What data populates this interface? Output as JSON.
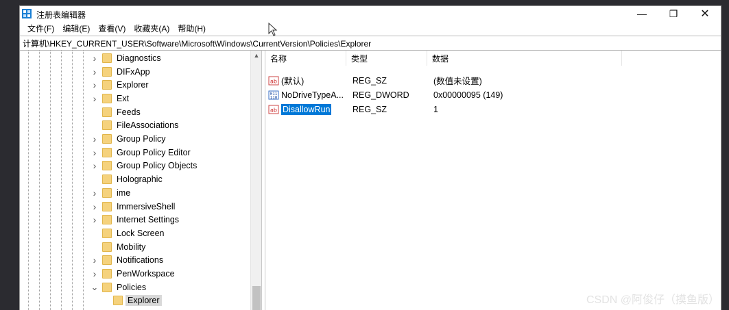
{
  "window": {
    "title": "注册表编辑器",
    "controls": {
      "minimize": "—",
      "maximize": "❐",
      "close": "✕"
    }
  },
  "menu": [
    "文件(F)",
    "编辑(E)",
    "查看(V)",
    "收藏夹(A)",
    "帮助(H)"
  ],
  "address": "计算机\\HKEY_CURRENT_USER\\Software\\Microsoft\\Windows\\CurrentVersion\\Policies\\Explorer",
  "tree": {
    "items": [
      {
        "label": "Diagnostics",
        "expandable": true
      },
      {
        "label": "DIFxApp",
        "expandable": true
      },
      {
        "label": "Explorer",
        "expandable": true
      },
      {
        "label": "Ext",
        "expandable": true
      },
      {
        "label": "Feeds",
        "expandable": false
      },
      {
        "label": "FileAssociations",
        "expandable": false
      },
      {
        "label": "Group Policy",
        "expandable": true
      },
      {
        "label": "Group Policy Editor",
        "expandable": true
      },
      {
        "label": "Group Policy Objects",
        "expandable": true
      },
      {
        "label": "Holographic",
        "expandable": false
      },
      {
        "label": "ime",
        "expandable": true
      },
      {
        "label": "ImmersiveShell",
        "expandable": true
      },
      {
        "label": "Internet Settings",
        "expandable": true
      },
      {
        "label": "Lock Screen",
        "expandable": false
      },
      {
        "label": "Mobility",
        "expandable": false
      },
      {
        "label": "Notifications",
        "expandable": true
      },
      {
        "label": "PenWorkspace",
        "expandable": true
      },
      {
        "label": "Policies",
        "expandable": true,
        "expanded": true
      },
      {
        "label": "Explorer",
        "expandable": false,
        "child": true,
        "selected": true
      }
    ]
  },
  "list": {
    "headers": {
      "name": "名称",
      "type": "类型",
      "data": "数据"
    },
    "rows": [
      {
        "name": "(默认)",
        "type": "REG_SZ",
        "data": "(数值未设置)",
        "icon": "string-value-icon"
      },
      {
        "name": "NoDriveTypeA...",
        "type": "REG_DWORD",
        "data": "0x00000095 (149)",
        "icon": "binary-value-icon"
      },
      {
        "name": "DisallowRun",
        "type": "REG_SZ",
        "data": "1",
        "icon": "string-value-icon",
        "selected": true
      }
    ]
  },
  "watermark": "CSDN @阿俊仔（摸鱼版）"
}
